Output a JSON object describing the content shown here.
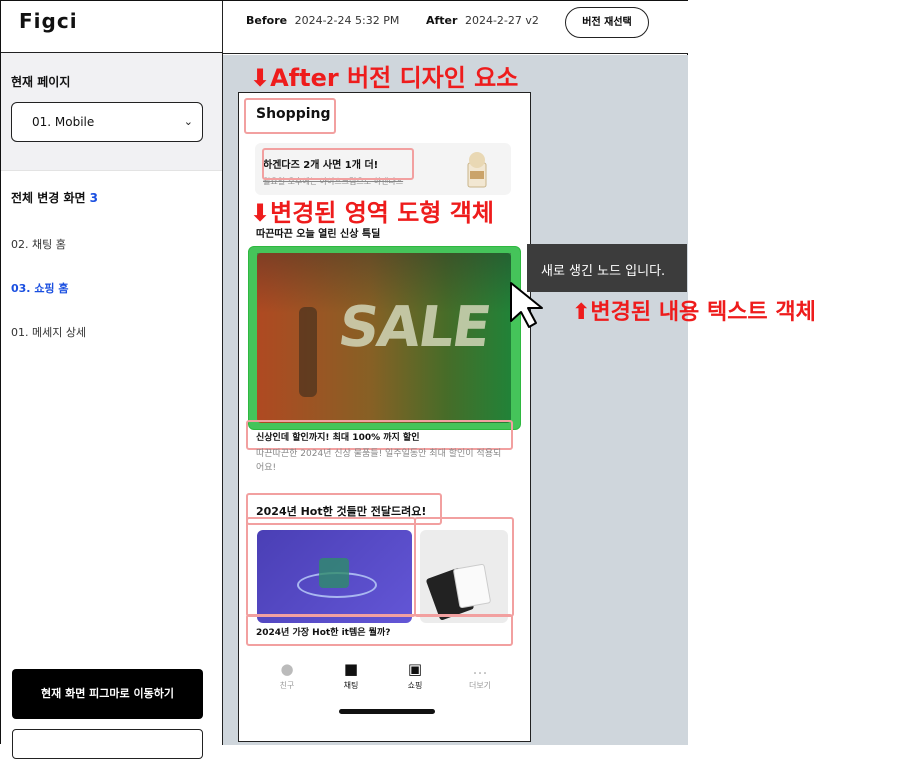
{
  "app": {
    "logo": "Figci"
  },
  "sidebar": {
    "current_page_label": "현재 페이지",
    "page_select_value": "01. Mobile",
    "changes_header": "전체 변경 화면",
    "changes_count": "3",
    "items": [
      {
        "label": "02. 채팅 홈",
        "active": false
      },
      {
        "label": "03. 쇼핑 홈",
        "active": true
      },
      {
        "label": "01. 메세지 상세",
        "active": false
      }
    ],
    "goto_figma_button": "현재 화면 피그마로 이동하기"
  },
  "topbar": {
    "before_label": "Before",
    "before_value": "2024-2-24 5:32 PM",
    "after_label": "After",
    "after_value": "2024-2-27 v2",
    "reselect_button": "버전 재선택"
  },
  "annotations": {
    "after_design": "⬇After 버전 디자인 요소",
    "changed_area": "⬇변경된 영역 도형 객체",
    "changed_text": "⬆변경된 내용 텍스트 객체"
  },
  "phone": {
    "title": "Shopping",
    "promo_title": "하겐다즈 2개 사면 1개 더!",
    "promo_sub": "월요일 오후에는 아이스크림으로 하겐다즈",
    "headline": "따끈따끈 오늘 열린 신상 특딜",
    "banner_text": "SALE",
    "desc_title": "신상인데 할인까지! 최대 100% 까지 할인",
    "desc_body": "따끈따끈한 2024년 신상 물품들! 일주일동안 최대 할인이 적용되어요!",
    "hot_title": "2024년 Hot한 것들만 전달드려요!",
    "card_caption": "2024년 가장 Hot한 it템은 뭘까?",
    "nav": [
      {
        "label": "친구",
        "icon": "person-icon"
      },
      {
        "label": "채팅",
        "icon": "chat-icon"
      },
      {
        "label": "쇼핑",
        "icon": "shopping-bag-icon"
      },
      {
        "label": "더보기",
        "icon": "more-icon"
      }
    ]
  },
  "tooltip": "새로 생긴 노드 입니다.",
  "colors": {
    "accent": "#1a4fe0",
    "annotation": "#ee1c1c",
    "changed_area": "#45c45a",
    "canvas": "#cfd6dc"
  }
}
